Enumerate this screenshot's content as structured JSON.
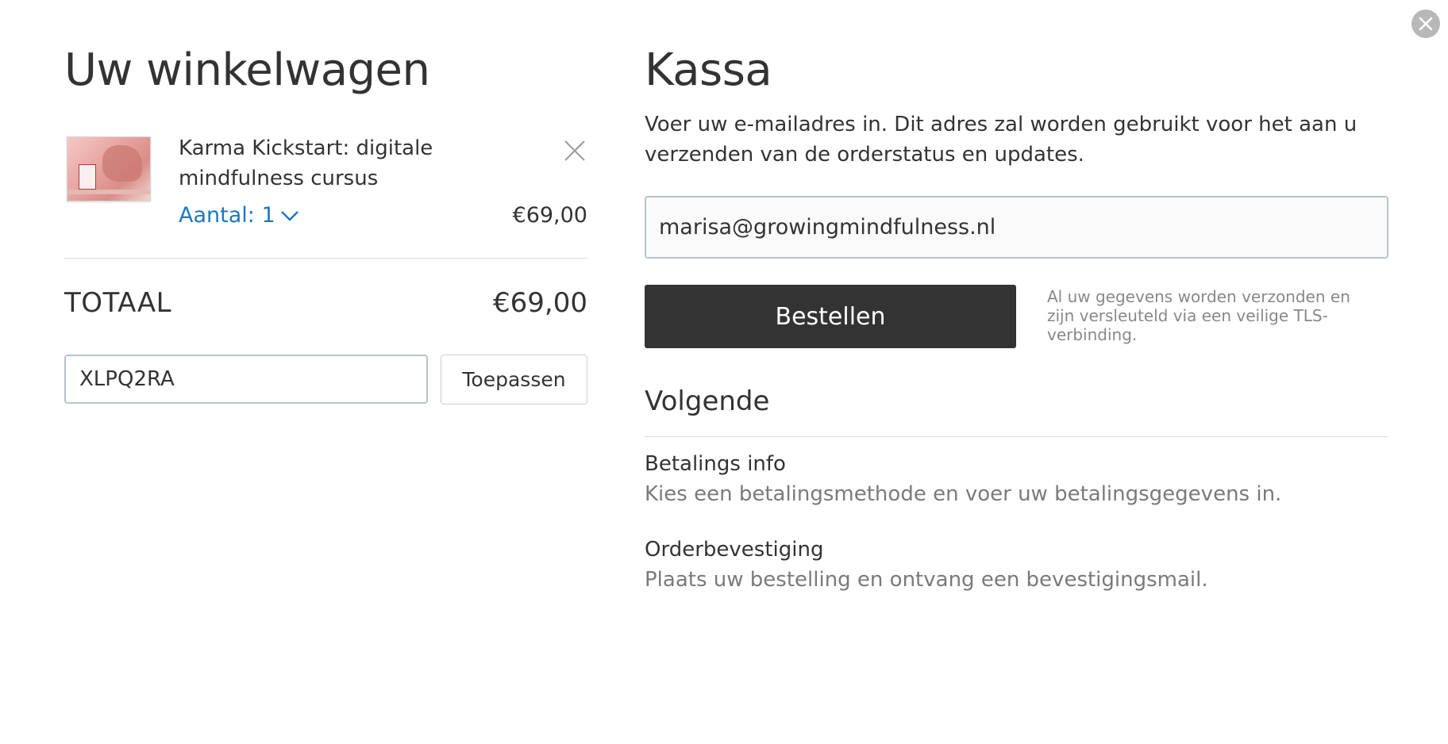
{
  "cart": {
    "title": "Uw winkelwagen",
    "item": {
      "title": "Karma Kickstart: digitale mindfulness cursus",
      "quantity_label": "Aantal: 1",
      "price": "€69,00"
    },
    "total_label": "TOTAAL",
    "total_value": "€69,00",
    "coupon_value": "XLPQ2RA",
    "apply_label": "Toepassen"
  },
  "checkout": {
    "title": "Kassa",
    "intro": "Voer uw e-mailadres in. Dit adres zal worden gebruikt voor het aan u verzenden van de orderstatus en updates.",
    "email_value": "marisa@growingmindfulness.nl",
    "order_button": "Bestellen",
    "secure_note": "Al uw gegevens worden verzonden en zijn versleuteld via een veilige TLS-verbinding.",
    "next_title": "Volgende",
    "steps": [
      {
        "title": "Betalings info",
        "description": "Kies een betalingsmethode en voer uw betalingsgegevens in."
      },
      {
        "title": "Orderbevestiging",
        "description": "Plaats uw bestelling en ontvang een bevestigingsmail."
      }
    ]
  },
  "icons": {
    "close": "close-icon",
    "remove": "remove-item-icon",
    "chevron": "chevron-down-icon"
  },
  "colors": {
    "primary_button": "#333333",
    "link": "#1a78c2",
    "muted_text": "#7a7a7a"
  }
}
